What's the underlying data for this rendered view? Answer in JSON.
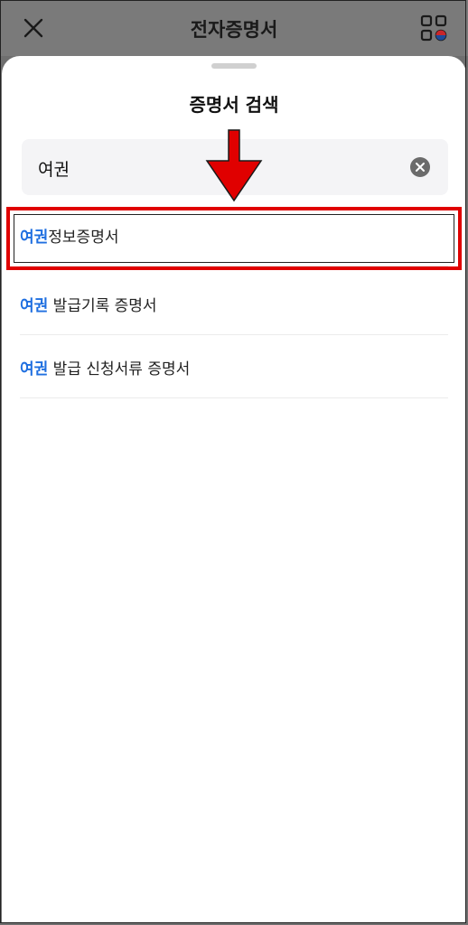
{
  "topbar": {
    "title": "전자증명서",
    "close_icon": "close-icon",
    "menu_icon": "grid-menu-icon"
  },
  "sheet": {
    "title": "증명서 검색"
  },
  "search": {
    "value": "여권",
    "clear_icon": "clear-icon"
  },
  "results": [
    {
      "highlight": "여권",
      "rest": "정보증명서"
    },
    {
      "highlight": "여권",
      "rest": " 발급기록 증명서"
    },
    {
      "highlight": "여권",
      "rest": " 발급 신청서류 증명서"
    }
  ],
  "annotation": {
    "arrow_color": "#e00000",
    "box_color": "#e00000"
  },
  "colors": {
    "accent": "#1f6fe0",
    "overlay": "#7a7a7a"
  }
}
